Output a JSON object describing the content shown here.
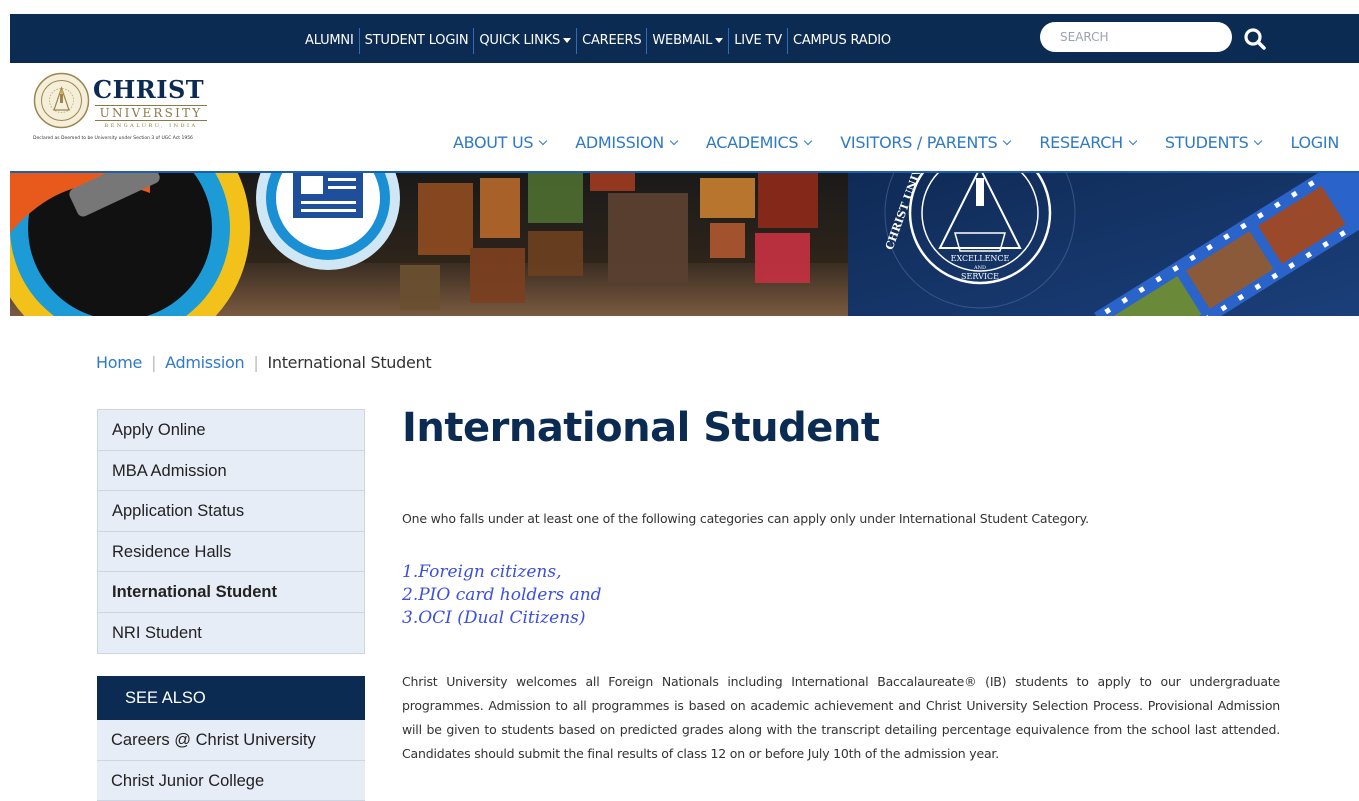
{
  "topbar": {
    "links": [
      {
        "label": "ALUMNI",
        "dropdown": false
      },
      {
        "label": "STUDENT LOGIN",
        "dropdown": false
      },
      {
        "label": "QUICK LINKS",
        "dropdown": true
      },
      {
        "label": "CAREERS",
        "dropdown": false
      },
      {
        "label": "WEBMAIL",
        "dropdown": true
      },
      {
        "label": "LIVE TV",
        "dropdown": false
      },
      {
        "label": "CAMPUS RADIO",
        "dropdown": false
      }
    ],
    "search_placeholder": "SEARCH",
    "search_icon": "search-icon",
    "background": "#0c2b52"
  },
  "logo": {
    "name": "CHRIST",
    "subtitle": "UNIVERSITY",
    "location": "BENGALURU, INDIA",
    "tagline": "Declared as Deemed to be University under Section 3 of UGC Act 1956"
  },
  "mainnav": {
    "items": [
      {
        "label": "ABOUT US",
        "dropdown": true
      },
      {
        "label": "ADMISSION",
        "dropdown": true
      },
      {
        "label": "ACADEMICS",
        "dropdown": true
      },
      {
        "label": "VISITORS / PARENTS",
        "dropdown": true
      },
      {
        "label": "RESEARCH",
        "dropdown": true
      },
      {
        "label": "STUDENTS",
        "dropdown": true
      },
      {
        "label": "LOGIN",
        "dropdown": false
      }
    ],
    "accent": "#2e7ac8"
  },
  "banner": {
    "seal_text_top": "CHRIST UNIVERSITY",
    "seal_motto_1": "EXCELLENCE",
    "seal_motto_2": "AND",
    "seal_motto_3": "SERVICE"
  },
  "breadcrumb": {
    "items": [
      "Home",
      "Admission",
      "International Student"
    ]
  },
  "sidebar": {
    "items": [
      {
        "label": "Apply Online",
        "active": false
      },
      {
        "label": "MBA Admission",
        "active": false
      },
      {
        "label": "Application Status",
        "active": false
      },
      {
        "label": "Residence Halls",
        "active": false
      },
      {
        "label": "International Student",
        "active": true
      },
      {
        "label": "NRI Student",
        "active": false
      }
    ],
    "see_also_title": "SEE ALSO",
    "see_also_items": [
      "Careers @ Christ University",
      "Christ Junior College"
    ]
  },
  "content": {
    "title": "International Student",
    "intro": "One who falls under at least one of the following categories can apply only under International Student Category.",
    "categories": [
      "1.Foreign citizens,",
      "2.PIO card holders and",
      "3.OCI (Dual Citizens)"
    ],
    "body": "Christ University welcomes all Foreign Nationals including International Baccalaureate® (IB) students to apply to our undergraduate programmes. Admission to all programmes is based on academic achievement and Christ University Selection Process. Provisional Admission will be given to students based on predicted grades along with the transcript detailing percentage equivalence from the school last attended. Candidates should submit the final results of class 12 on or before July 10th of the admission year."
  }
}
